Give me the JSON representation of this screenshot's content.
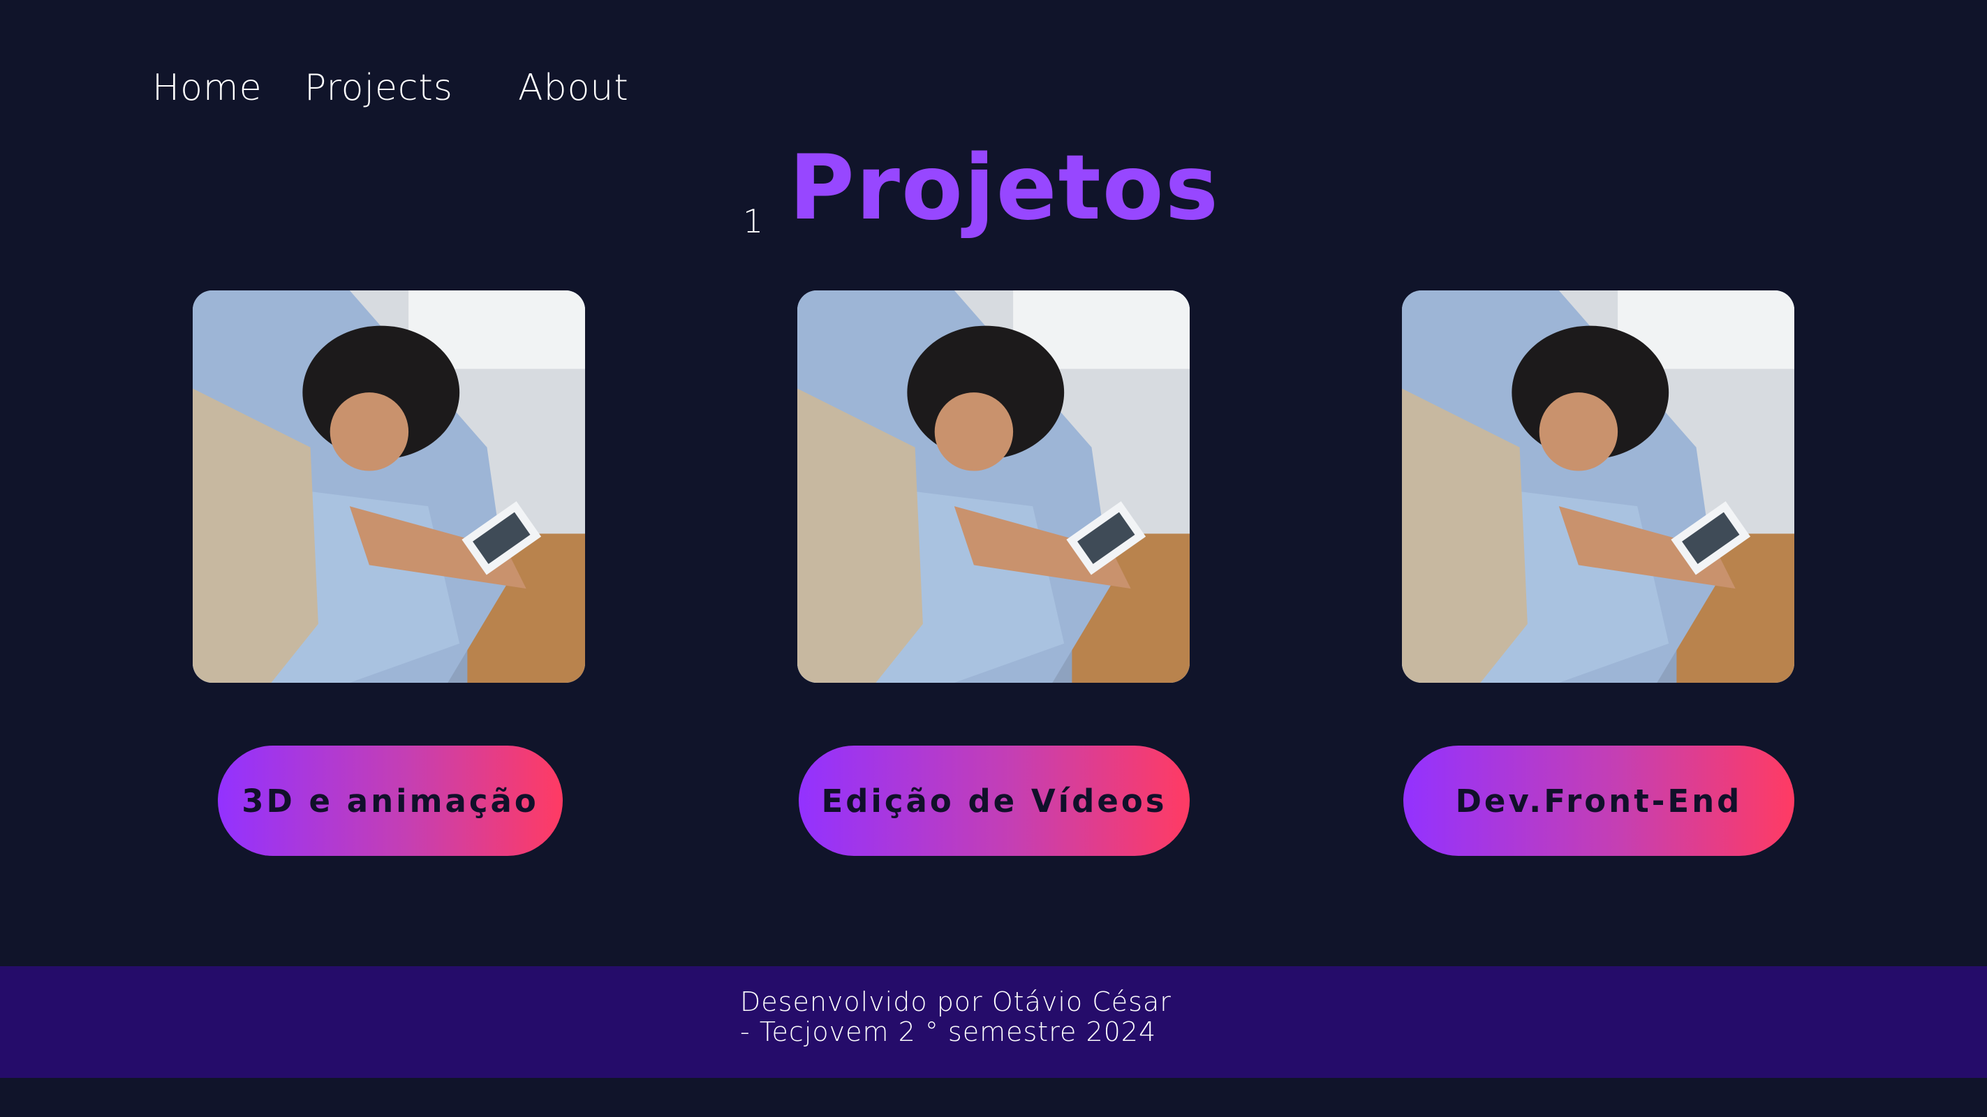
{
  "nav": {
    "home": "Home",
    "projects": "Projects",
    "about": "About"
  },
  "hero": {
    "index": "1",
    "title": "Projetos"
  },
  "projects": [
    {
      "image": "person-with-tablet-photo",
      "label": "3D e animação"
    },
    {
      "image": "person-with-tablet-photo",
      "label": "Edição de Vídeos"
    },
    {
      "image": "person-with-tablet-photo",
      "label": "Dev.Front-End"
    }
  ],
  "footer": {
    "line1": "Desenvolvido por Otávio César",
    "line2": "- Tecjovem 2 ° semestre 2024"
  },
  "colors": {
    "background": "#10142a",
    "title_accent": "#9747ff",
    "footer_background": "#250c6a",
    "button_gradient_start": "#9332ff",
    "button_gradient_end": "#ff3b63"
  }
}
